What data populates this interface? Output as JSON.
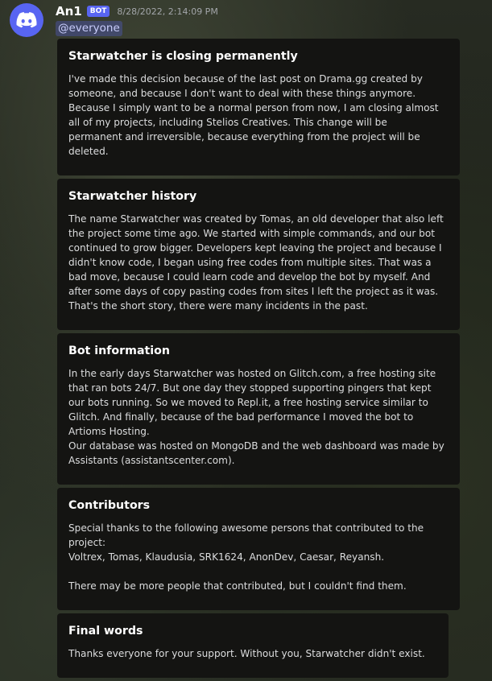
{
  "message": {
    "username": "An1",
    "bot_tag": "BOT",
    "timestamp": "8/28/2022, 2:14:09 PM",
    "mention": "@everyone",
    "avatar_icon": "discord-logo-icon",
    "avatar_color": "#5865f2"
  },
  "embeds": [
    {
      "title": "Starwatcher is closing permanently",
      "lines": [
        "I've made this decision because of the last post on Drama.gg created by",
        "someone, and because I don't want to deal with these things anymore.",
        "Because I simply want to be a normal person from now, I am closing almost",
        "all of my projects, including Stelios Creatives. This change will be",
        "permanent and irreversible, because everything from the project will be",
        "deleted."
      ]
    },
    {
      "title": "Starwatcher history",
      "lines": [
        "The name Starwatcher was created by Tomas, an old developer that also left",
        "the project some time ago. We started with simple commands, and our bot",
        "continued to grow bigger. Developers kept leaving the project and because I",
        "didn't know code, I began using free codes from multiple sites. That was a",
        "bad move, because I could learn code and develop the bot by myself. And",
        "after some days of copy pasting codes from sites I left the project as it was.",
        "That's the short story, there were many incidents in the past."
      ]
    },
    {
      "title": "Bot information",
      "lines": [
        "In the early days Starwatcher was hosted on Glitch.com, a free hosting site",
        "that ran bots 24/7. But one day they stopped supporting pingers that kept",
        "our bots running. So we moved to Repl.it, a free hosting service similar to",
        "Glitch. And finally, because of the bad performance I moved the bot to",
        "Artioms Hosting.",
        "Our database was hosted on MongoDB and the web dashboard was made by",
        "Assistants (assistantscenter.com)."
      ]
    },
    {
      "title": "Contributors",
      "lines": [
        "Special thanks to the following awesome persons that contributed to the",
        "project:",
        "Voltrex, Tomas, Klaudusia, SRK1624, AnonDev, Caesar, Reyansh.",
        "",
        "There may be more people that contributed, but I couldn't find them."
      ]
    },
    {
      "title": "Final words",
      "lines": [
        "Thanks everyone for your support. Without you, Starwatcher didn't exist."
      ]
    }
  ]
}
